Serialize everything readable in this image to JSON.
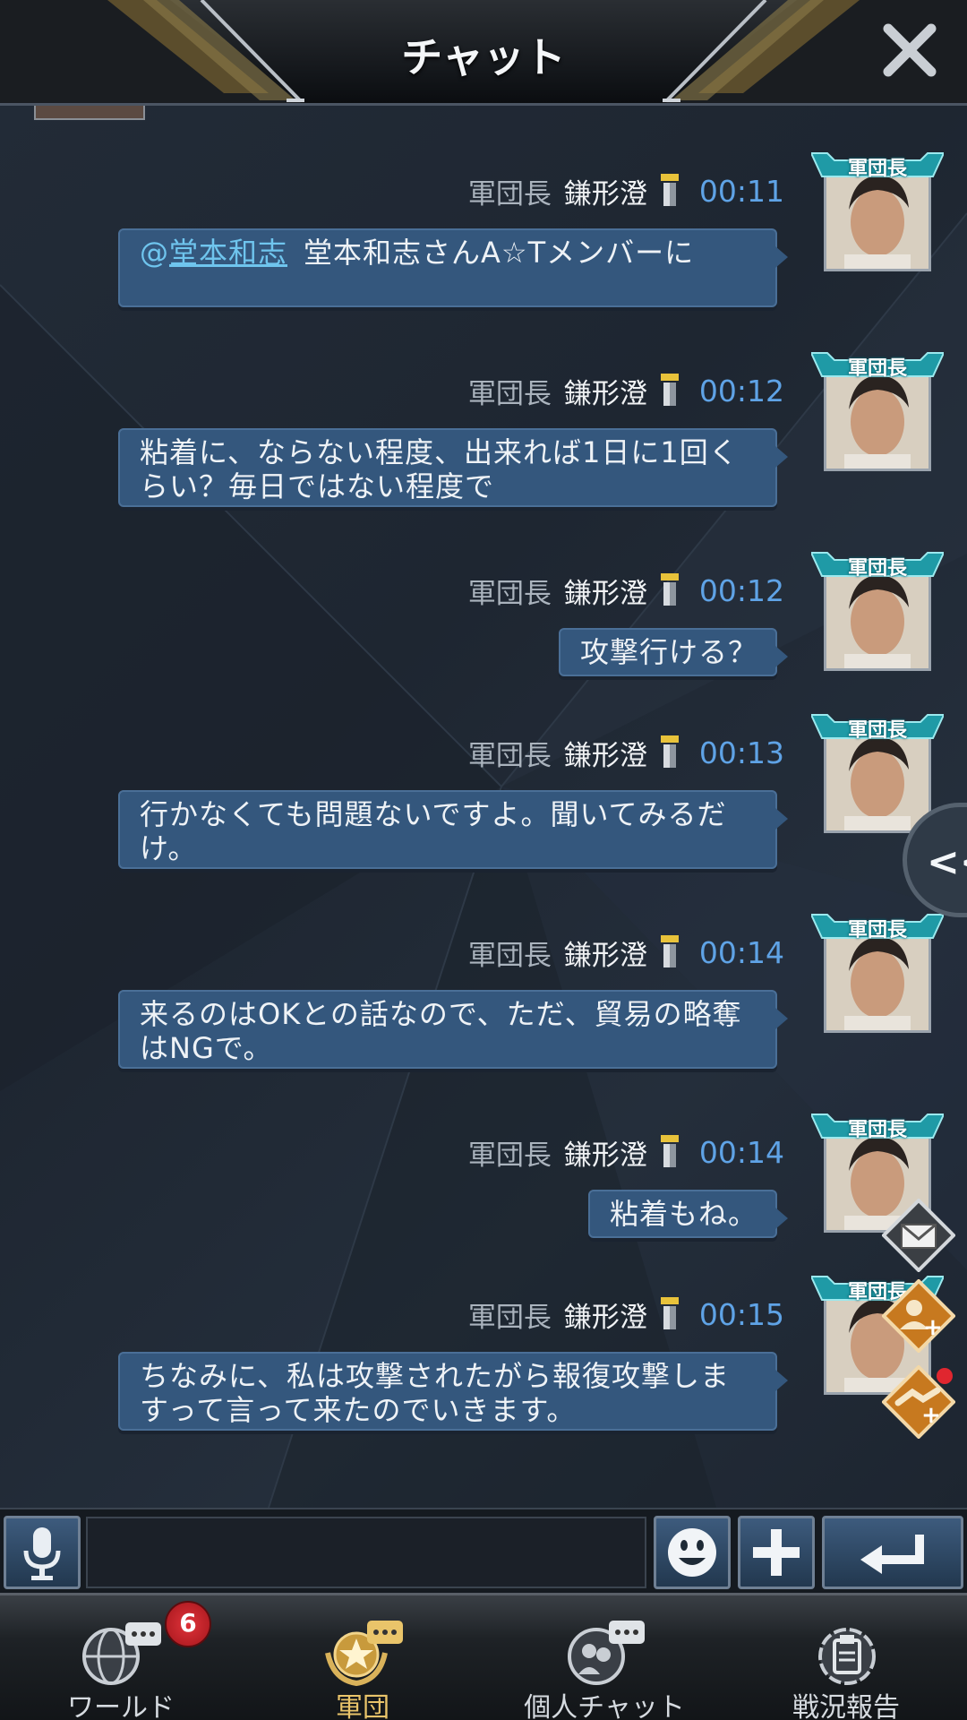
{
  "header": {
    "title": "チャット"
  },
  "messages": [
    {
      "rank": "軍団長",
      "sender": "鎌形澄",
      "time": "00:11",
      "mention_at": "@",
      "mention_name": "堂本和志",
      "text": "堂本和志さんA☆Tメンバーに",
      "badge": "軍団長"
    },
    {
      "rank": "軍団長",
      "sender": "鎌形澄",
      "time": "00:12",
      "text": "粘着に、ならない程度、出来れば1日に1回くらい？毎日ではない程度で",
      "badge": "軍団長"
    },
    {
      "rank": "軍団長",
      "sender": "鎌形澄",
      "time": "00:12",
      "text": "攻撃行ける？",
      "badge": "軍団長"
    },
    {
      "rank": "軍団長",
      "sender": "鎌形澄",
      "time": "00:13",
      "text": "行かなくても問題ないですよ。聞いてみるだけ。",
      "badge": "軍団長"
    },
    {
      "rank": "軍団長",
      "sender": "鎌形澄",
      "time": "00:14",
      "text": "来るのはOKとの話なので、ただ、貿易の略奪はNGで。",
      "badge": "軍団長"
    },
    {
      "rank": "軍団長",
      "sender": "鎌形澄",
      "time": "00:14",
      "text": "粘着もね。",
      "badge": "軍団長"
    },
    {
      "rank": "軍団長",
      "sender": "鎌形澄",
      "time": "00:15",
      "text": "ちなみに、私は攻撃されたがら報復攻撃しますって言って来たのでいきます。",
      "badge": "軍団長"
    }
  ],
  "side_tab": {
    "label": "<<"
  },
  "input": {
    "value": "",
    "placeholder": ""
  },
  "nav": [
    {
      "label": "ワールド",
      "badge": "6"
    },
    {
      "label": "軍団"
    },
    {
      "label": "個人チャット"
    },
    {
      "label": "戦況報告"
    }
  ],
  "colors": {
    "bubble": "#34577d",
    "time": "#5fa3e6",
    "mention": "#6fc5ee",
    "active_nav": "#e9c46a",
    "badge_red": "#c62028"
  }
}
